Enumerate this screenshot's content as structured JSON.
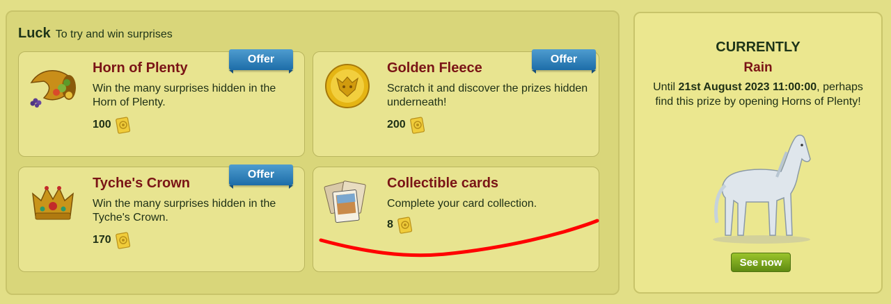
{
  "luck": {
    "title": "Luck",
    "subtitle": "To try and win surprises",
    "cards": [
      {
        "title": "Horn of Plenty",
        "description": "Win the many surprises hidden in the Horn of Plenty.",
        "price": "100",
        "offer": "Offer",
        "icon": "cornucopia-icon"
      },
      {
        "title": "Golden Fleece",
        "description": "Scratch it and discover the prizes hidden underneath!",
        "price": "200",
        "offer": "Offer",
        "icon": "golden-fleece-icon"
      },
      {
        "title": "Tyche's Crown",
        "description": "Win the many surprises hidden in the Tyche's Crown.",
        "price": "170",
        "offer": "Offer",
        "icon": "crown-icon"
      },
      {
        "title": "Collectible cards",
        "description": "Complete your card collection.",
        "price": "8",
        "icon": "cards-icon"
      }
    ],
    "currency_icon": "pass-ticket-icon"
  },
  "current": {
    "heading": "CURRENTLY",
    "weather": "Rain",
    "until_prefix": "Until ",
    "until_date": "21st August 2023 11:00:00",
    "until_suffix": ", perhaps find this prize by opening Horns of Plenty!",
    "image": "white-horse",
    "button_label": "See now"
  },
  "colors": {
    "background": "#e2df87",
    "card_title": "#7a1416",
    "offer_ribbon": "#2a7fbb",
    "button_green": "#7aa91f",
    "annotation_red": "#ff0000"
  }
}
